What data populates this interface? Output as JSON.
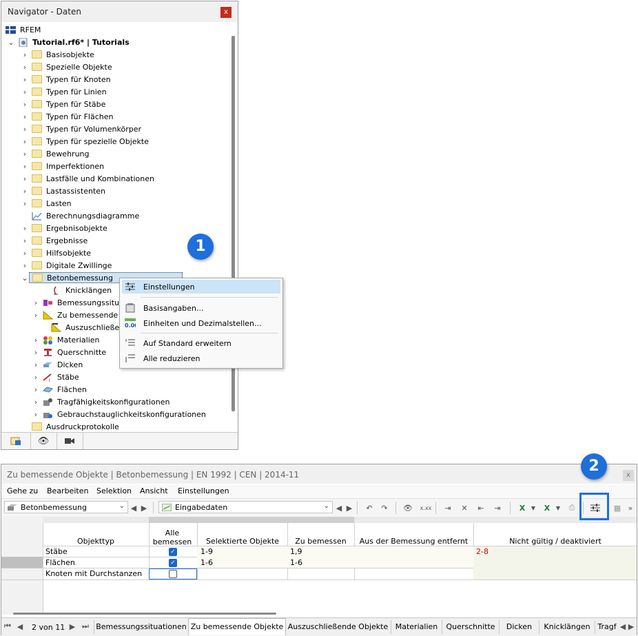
{
  "navigator": {
    "title": "Navigator - Daten",
    "close": "x",
    "root": "RFEM",
    "project": "Tutorial.rf6* | Tutorials",
    "folders": [
      "Basisobjekte",
      "Spezielle Objekte",
      "Typen für Knoten",
      "Typen für Linien",
      "Typen für Stäbe",
      "Typen für Flächen",
      "Typen für Volumenkörper",
      "Typen für spezielle Objekte",
      "Bewehrung",
      "Imperfektionen",
      "Lastfälle und Kombinationen",
      "Lastassistenten",
      "Lasten"
    ],
    "calc_diagrams": "Berechnungsdiagramme",
    "folders2": [
      "Ergebnisobjekte",
      "Ergebnisse",
      "Hilfsobjekte",
      "Digitale Zwillinge"
    ],
    "selected": "Betonbemessung",
    "children": [
      "Knicklängen",
      "Bemessungssitu",
      "Zu bemessende",
      "Auszuschließend",
      "Materialien",
      "Querschnitte",
      "Dicken",
      "Stäbe",
      "Flächen",
      "Tragfähigkeitskonfigurationen",
      "Gebrauchstauglichkeitskonfigurationen"
    ],
    "last": "Ausdruckprotokolle"
  },
  "context_menu": {
    "items": [
      "Einstellungen",
      "Basisangaben...",
      "Einheiten und Dezimalstellen...",
      "Auf Standard erweitern",
      "Alle reduzieren"
    ]
  },
  "badges": [
    "1",
    "2"
  ],
  "table_window": {
    "title": "Zu bemessende Objekte | Betonbemessung | EN 1992 | CEN | 2014-11",
    "close": "x",
    "menu": [
      "Gehe zu",
      "Bearbeiten",
      "Selektion",
      "Ansicht",
      "Einstellungen"
    ],
    "combo1": "Betonbemessung",
    "combo2": "Eingabedaten",
    "columns": [
      "Objekttyp",
      "Alle bemessen",
      "Selektierte Objekte",
      "Zu bemessen",
      "Aus der Bemessung entfernt",
      "Nicht gültig / deaktiviert"
    ],
    "rows": [
      {
        "type": "Stäbe",
        "all": true,
        "selected": "1-9",
        "to_design": "1,9",
        "removed": "",
        "invalid": "2-8"
      },
      {
        "type": "Flächen",
        "all": true,
        "selected": "1-6",
        "to_design": "1-6",
        "removed": "",
        "invalid": ""
      },
      {
        "type": "Knoten mit Durchstanzen",
        "all": false,
        "selected": "",
        "to_design": "",
        "removed": "",
        "invalid": ""
      }
    ],
    "pager": "2 von 11",
    "tabs": [
      "Bemessungssituationen",
      "Zu bemessende Objekte",
      "Auszuschließende Objekte",
      "Materialien",
      "Querschnitte",
      "Dicken",
      "Knicklängen",
      "Tragf"
    ],
    "more": "»"
  },
  "colors": {
    "accent": "#1e6fd9",
    "invalid_text": "#d00000"
  }
}
